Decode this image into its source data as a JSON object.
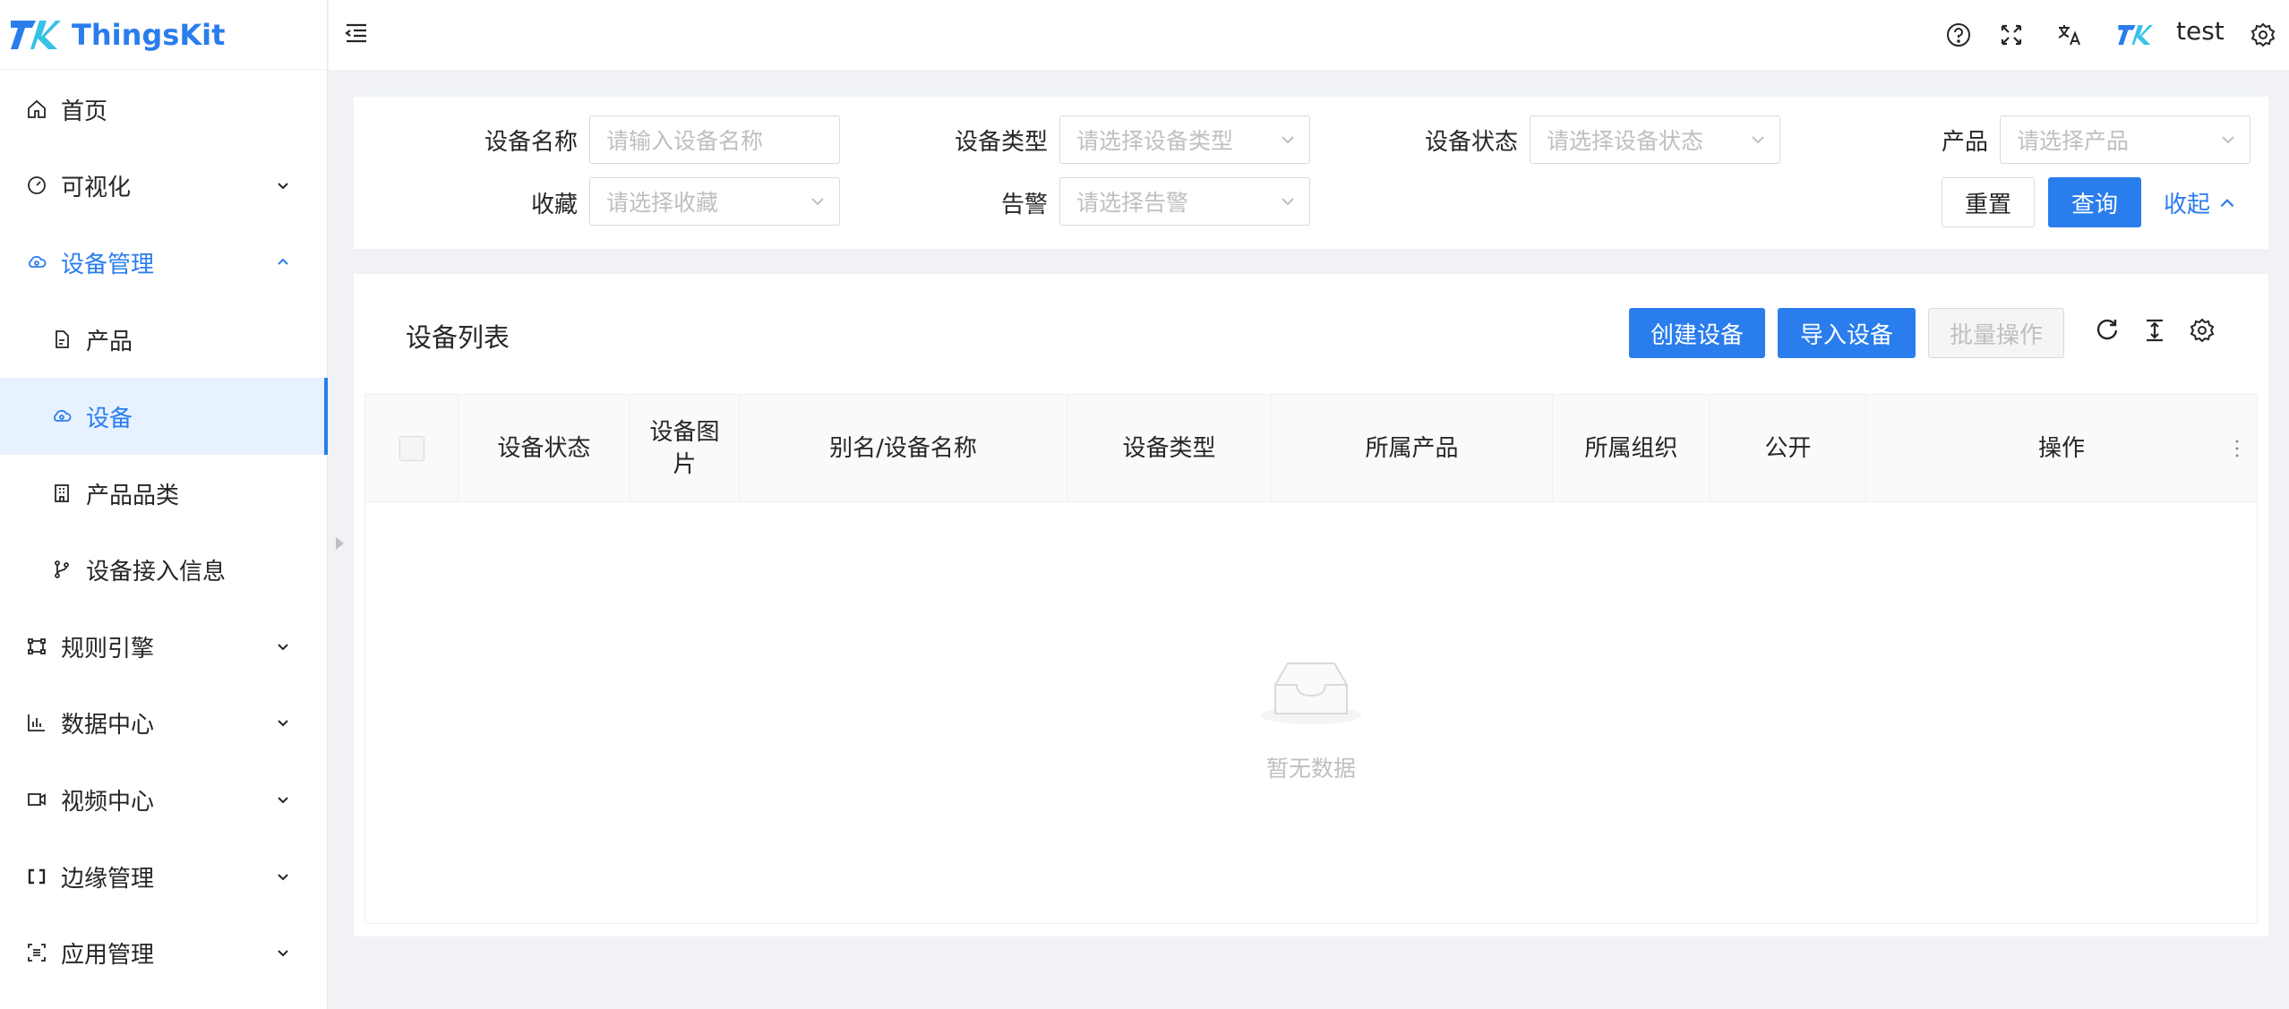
{
  "app": {
    "name": "ThingsKit",
    "brand_color": "#2a7dec"
  },
  "sidebar": {
    "items": [
      {
        "label": "首页",
        "icon": "home-icon",
        "expandable": false
      },
      {
        "label": "可视化",
        "icon": "dashboard-icon",
        "expandable": true
      },
      {
        "label": "设备管理",
        "icon": "device-cloud-icon",
        "expandable": true,
        "open": true
      },
      {
        "label": "产品",
        "icon": "file-icon",
        "sub": true
      },
      {
        "label": "设备",
        "icon": "device-cloud-icon",
        "sub": true,
        "active": true
      },
      {
        "label": "产品品类",
        "icon": "building-icon",
        "sub": true
      },
      {
        "label": "设备接入信息",
        "icon": "branch-icon",
        "sub": true
      },
      {
        "label": "规则引擎",
        "icon": "rule-icon",
        "expandable": true
      },
      {
        "label": "数据中心",
        "icon": "bar-chart-icon",
        "expandable": true
      },
      {
        "label": "视频中心",
        "icon": "video-icon",
        "expandable": true
      },
      {
        "label": "边缘管理",
        "icon": "edge-icon",
        "expandable": true
      },
      {
        "label": "应用管理",
        "icon": "app-icon",
        "expandable": true
      }
    ]
  },
  "header": {
    "username": "test",
    "icons": [
      "menu-fold-icon",
      "help-icon",
      "fullscreen-icon",
      "translate-icon",
      "avatar-logo-icon",
      "settings-icon"
    ]
  },
  "filter": {
    "fields": [
      {
        "label": "设备名称",
        "placeholder": "请输入设备名称",
        "type": "input"
      },
      {
        "label": "设备类型",
        "placeholder": "请选择设备类型",
        "type": "select"
      },
      {
        "label": "设备状态",
        "placeholder": "请选择设备状态",
        "type": "select"
      },
      {
        "label": "产品",
        "placeholder": "请选择产品",
        "type": "select"
      },
      {
        "label": "收藏",
        "placeholder": "请选择收藏",
        "type": "select"
      },
      {
        "label": "告警",
        "placeholder": "请选择告警",
        "type": "select"
      }
    ],
    "reset_label": "重置",
    "query_label": "查询",
    "collapse_label": "收起"
  },
  "table": {
    "title": "设备列表",
    "create_label": "创建设备",
    "import_label": "导入设备",
    "batch_label": "批量操作",
    "columns": [
      "设备状态",
      "设备图\n片",
      "别名/设备名称",
      "设备类型",
      "所属产品",
      "所属组织",
      "公开",
      "操作"
    ],
    "empty_text": "暂无数据",
    "rows": []
  }
}
